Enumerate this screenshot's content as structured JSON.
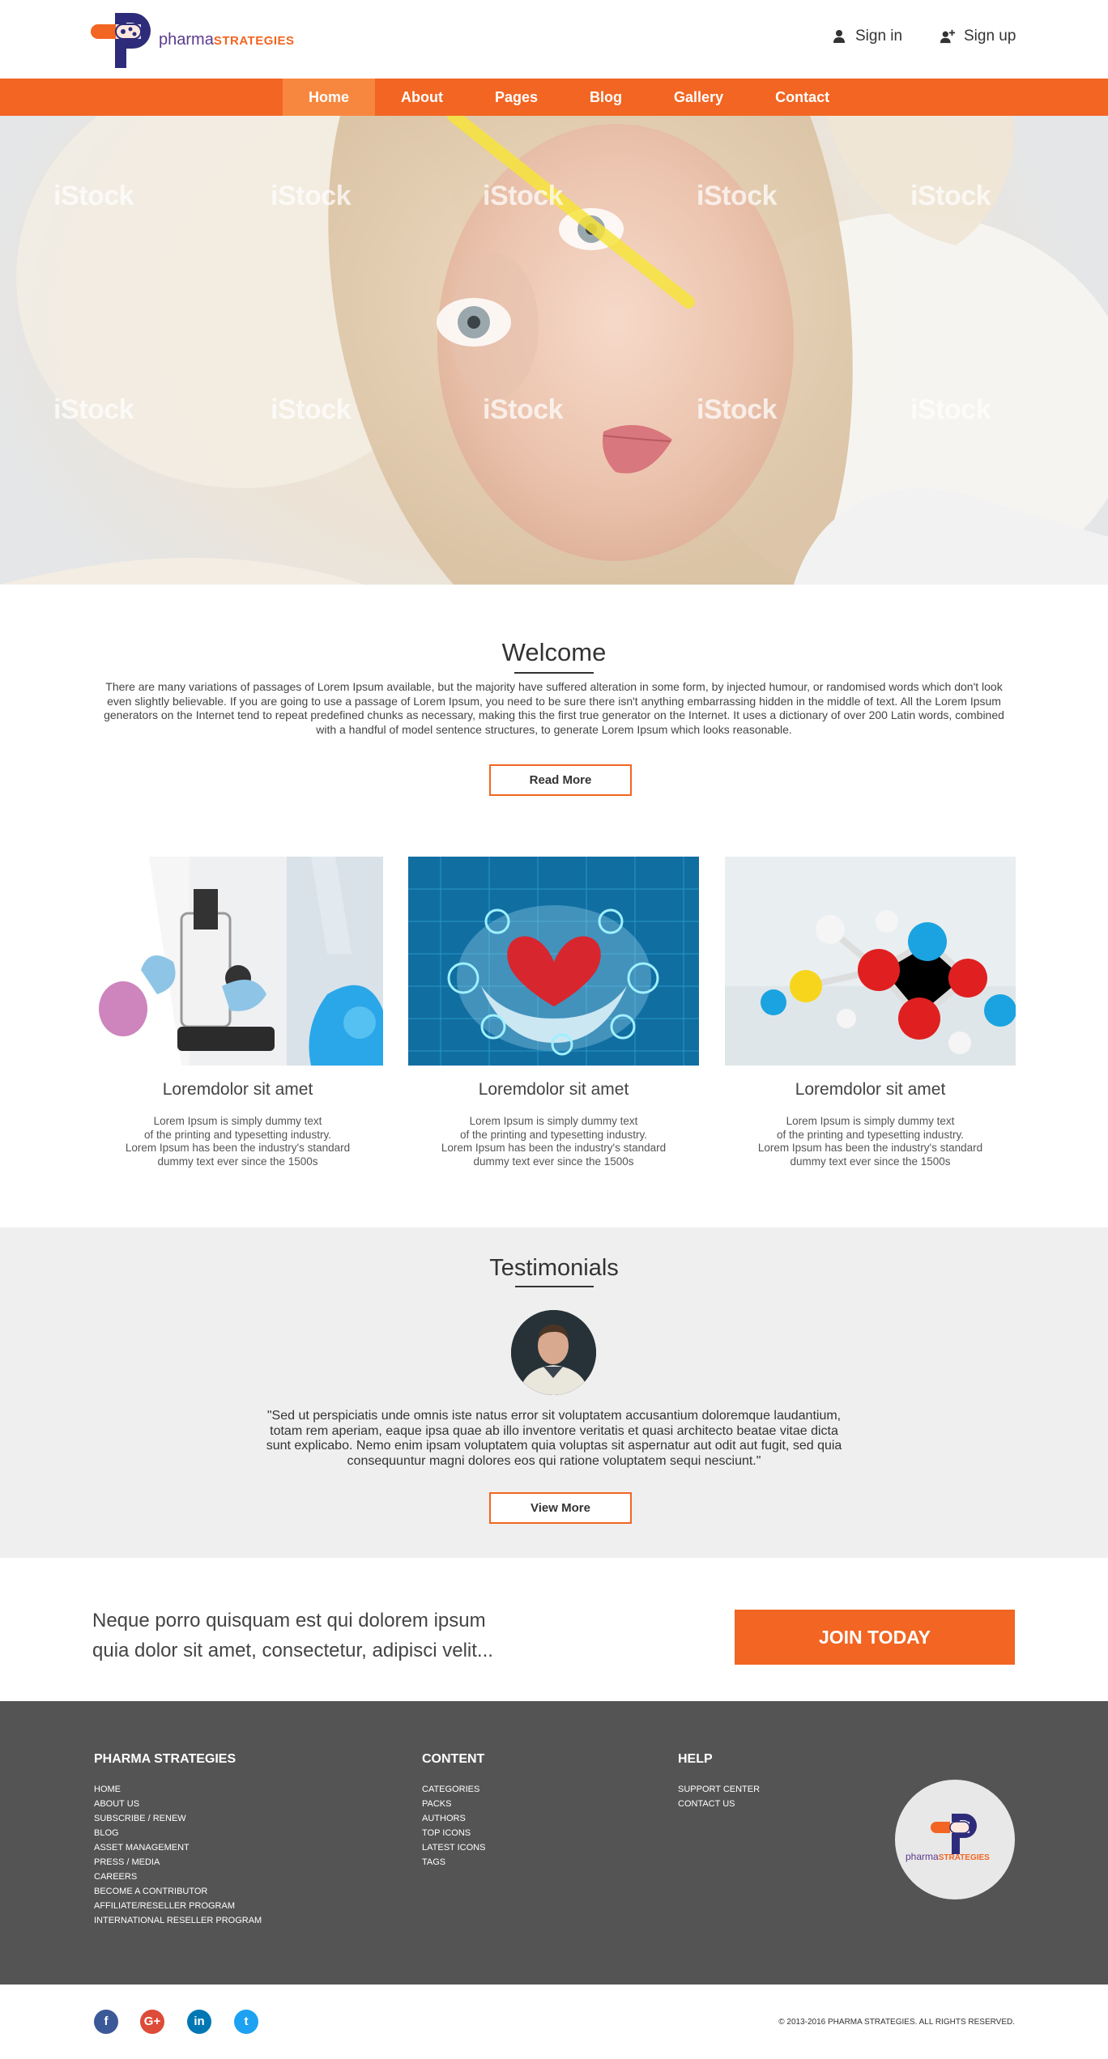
{
  "header": {
    "logo_name": "pharma",
    "logo_strong": "STRATEGIES",
    "signin_label": "Sign in",
    "signup_label": "Sign up"
  },
  "nav": {
    "items": [
      "Home",
      "About",
      "Pages",
      "Blog",
      "Gallery",
      "Contact"
    ],
    "active": "Home"
  },
  "hero": {
    "watermark": "iStock"
  },
  "welcome": {
    "title": "Welcome",
    "text": "There are many variations of passages of Lorem Ipsum available, but the majority have suffered alteration in some form, by injected humour, or randomised words which don't look even slightly believable. If you are going to use a passage of Lorem Ipsum, you need to be sure there isn't anything embarrassing hidden in the middle of text. All the  Lorem Ipsum generators on the Internet tend to repeat predefined chunks as necessary, making this the first true generator on the Internet. It uses a dictionary of over 200 Latin words, combined with a handful of model sentence structures, to generate Lorem Ipsum which looks reasonable.",
    "button": "Read More"
  },
  "cards": [
    {
      "title": "Loremdolor sit amet",
      "text": "Lorem Ipsum is simply dummy text\nof the printing and typesetting industry.\nLorem Ipsum has been the industry's standard\ndummy text ever since the 1500s"
    },
    {
      "title": "Loremdolor sit amet",
      "text": "Lorem Ipsum is simply dummy text\nof the printing and typesetting industry.\nLorem Ipsum has been the industry's standard\ndummy text ever since the 1500s"
    },
    {
      "title": "Loremdolor sit amet",
      "text": "Lorem Ipsum is simply dummy text\nof the printing and typesetting industry.\nLorem Ipsum has been the industry's standard\ndummy text ever since the 1500s"
    }
  ],
  "testimonials": {
    "title": "Testimonials",
    "quote": "\"Sed ut perspiciatis unde omnis iste natus error sit voluptatem accusantium doloremque laudantium, totam rem aperiam, eaque ipsa quae ab illo inventore veritatis et quasi architecto beatae vitae dicta sunt explicabo. Nemo enim ipsam voluptatem quia voluptas sit aspernatur aut odit aut fugit, sed quia consequuntur magni dolores eos qui ratione voluptatem sequi nesciunt.\"",
    "button": "View More"
  },
  "cta": {
    "text": "Neque porro quisquam est qui dolorem ipsum\nquia dolor sit amet, consectetur, adipisci velit...",
    "button": "JOIN TODAY"
  },
  "footer": {
    "columns": [
      {
        "heading": "PHARMA STRATEGIES",
        "links": [
          "HOME",
          "ABOUT US",
          "SUBSCRIBE / RENEW",
          "BLOG",
          "ASSET MANAGEMENT",
          "PRESS / MEDIA",
          "CAREERS",
          "BECOME A CONTRIBUTOR",
          "AFFILIATE/RESELLER PROGRAM",
          "INTERNATIONAL RESELLER PROGRAM"
        ]
      },
      {
        "heading": "CONTENT",
        "links": [
          "CATEGORIES",
          "PACKS",
          "AUTHORS",
          "TOP ICONS",
          "LATEST ICONS",
          "TAGS"
        ]
      },
      {
        "heading": "HELP",
        "links": [
          "SUPPORT CENTER",
          "CONTACT US"
        ]
      }
    ],
    "logo_name": "pharma",
    "logo_strong": "STRATEGIES"
  },
  "bottom": {
    "social": [
      {
        "icon": "facebook-icon",
        "glyph": "f",
        "color": "#3b5998"
      },
      {
        "icon": "google-plus-icon",
        "glyph": "G+",
        "color": "#dd4b39"
      },
      {
        "icon": "linkedin-icon",
        "glyph": "in",
        "color": "#0077b5"
      },
      {
        "icon": "twitter-icon",
        "glyph": "t",
        "color": "#1da1f2"
      }
    ],
    "copyright": "© 2013-2016 PHARMA STRATEGIES. ALL RIGHTS RESERVED."
  },
  "colors": {
    "accent": "#f26522",
    "nav_active": "#f7873e",
    "brand_purple": "#2e2c7a",
    "footer_bg": "#545454",
    "testimonials_bg": "#efefef"
  }
}
